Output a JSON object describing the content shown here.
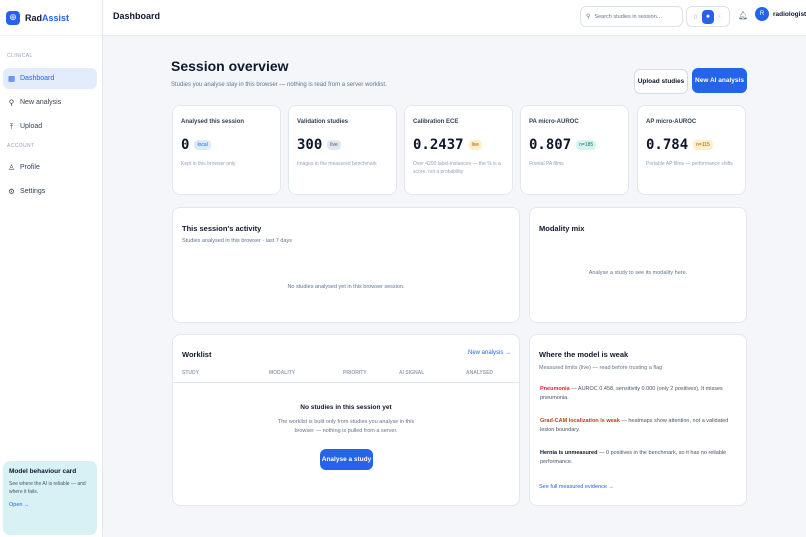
{
  "brand": {
    "name_a": "Rad",
    "name_b": "Assist",
    "logo_icon": "globe-icon"
  },
  "sidebar": {
    "sections": [
      {
        "label": "CLINICAL",
        "items": [
          {
            "label": "Dashboard",
            "icon": "grid-icon",
            "active": true
          },
          {
            "label": "New analysis",
            "icon": "bulb-icon"
          },
          {
            "label": "Upload",
            "icon": "upload-icon"
          }
        ]
      },
      {
        "label": "ACCOUNT",
        "items": [
          {
            "label": "Profile",
            "icon": "user-icon"
          },
          {
            "label": "Settings",
            "icon": "gear-icon"
          }
        ]
      }
    ],
    "card": {
      "title": "Model behaviour card",
      "text": "See where the AI is reliable — and where it fails.",
      "link": "Open →"
    }
  },
  "topbar": {
    "title": "Dashboard",
    "search_placeholder": "Search studies in session…",
    "theme_options": [
      "monitor",
      "sun",
      "moon"
    ],
    "theme_selected": "sun",
    "user": {
      "initial": "R",
      "name": "radiologist"
    }
  },
  "overview": {
    "title": "Session overview",
    "subtitle": "Studies you analyse stay in this browser — nothing is read from a server worklist.",
    "upload_button": "Upload studies",
    "new_button": "New AI analysis"
  },
  "kpis": [
    {
      "label": "Analysed this session",
      "value": "0",
      "badge": "local",
      "badge_style": "blue",
      "note": "Kept in this browser only"
    },
    {
      "label": "Validation studies",
      "value": "300",
      "badge": "live",
      "badge_style": "gray",
      "note": "Images in the measured benchmark"
    },
    {
      "label": "Calibration ECE",
      "value": "0.2437",
      "badge": "live",
      "badge_style": "amber",
      "note": "Over 4200 label-instances — the % is a score, not a probability"
    },
    {
      "label": "PA micro-AUROC",
      "value": "0.807",
      "badge": "n=185",
      "badge_style": "teal",
      "note": "Frontal PA films"
    },
    {
      "label": "AP micro-AUROC",
      "value": "0.784",
      "badge": "n=115",
      "badge_style": "amber",
      "note": "Portable AP films — performance shifts"
    }
  ],
  "activity": {
    "title": "This session's activity",
    "subtitle": "Studies analysed in this browser · last 7 days",
    "empty": "No studies analysed yet in this browser session."
  },
  "modality": {
    "title": "Modality mix",
    "empty": "Analyse a study to see its modality here."
  },
  "worklist": {
    "title": "Worklist",
    "link": "New analysis →",
    "columns": [
      "STUDY",
      "MODALITY",
      "PRIORITY",
      "AI SIGNAL",
      "ANALYSED"
    ],
    "empty_title": "No studies in this session yet",
    "empty_text": "The worklist is built only from studies you analyse in this browser — nothing is pulled from a server.",
    "button": "Analyse a study"
  },
  "weak": {
    "title": "Where the model is weak",
    "subtitle": "Measured limits (live) — read before trusting a flag",
    "items": [
      {
        "label": "Pneumonia",
        "text": " — AUROC 0.458, sensitivity 0.000 (only 2 positives). It misses pneumonia."
      },
      {
        "label": "Grad-CAM localization is weak",
        "text": " — heatmaps show attention, not a validated lesion boundary."
      },
      {
        "label": "Hernia is unmeasured",
        "text": " — 0 positives in the benchmark, so it has no reliable performance."
      }
    ],
    "link": "See full measured evidence →"
  }
}
